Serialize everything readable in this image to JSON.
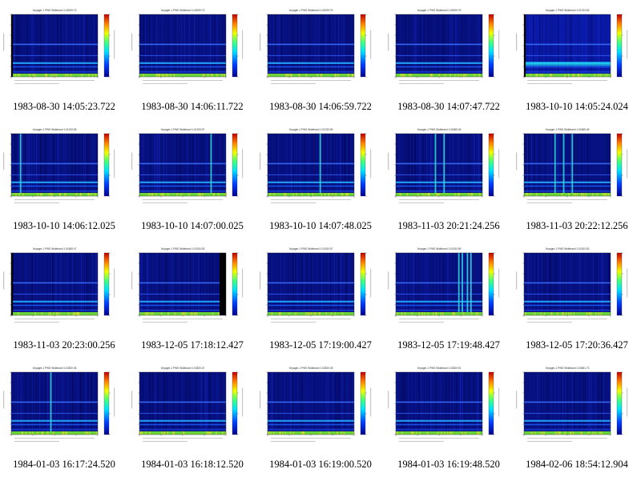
{
  "panels": [
    {
      "caption": "1983-08-30 14:05:23.722",
      "title": "Voyager-1 PWS Wideband 1:00029:73",
      "seed": 11,
      "leftEdge": true,
      "blackRight": false,
      "bright": false,
      "cyanBars": []
    },
    {
      "caption": "1983-08-30 14:06:11.722",
      "title": "Voyager-1 PWS Wideband 1:00029:73",
      "seed": 12,
      "leftEdge": false,
      "blackRight": false,
      "bright": false,
      "cyanBars": []
    },
    {
      "caption": "1983-08-30 14:06:59.722",
      "title": "Voyager-1 PWS Wideband 1:00029:75",
      "seed": 13,
      "leftEdge": false,
      "blackRight": false,
      "bright": false,
      "cyanBars": []
    },
    {
      "caption": "1983-08-30 14:07:47.722",
      "title": "Voyager-1 PWS Wideband 1:00029:75",
      "seed": 14,
      "leftEdge": false,
      "blackRight": false,
      "bright": false,
      "cyanBars": []
    },
    {
      "caption": "1983-10-10 14:05:24.024",
      "title": "Voyager-1 PWS Wideband 1:01233:53",
      "seed": 15,
      "leftEdge": true,
      "blackRight": false,
      "bright": true,
      "cyanBars": []
    },
    {
      "caption": "1983-10-10 14:06:12.025",
      "title": "Voyager-1 PWS Wideband 1:01233:55",
      "seed": 21,
      "leftEdge": false,
      "blackRight": false,
      "bright": false,
      "cyanBars": [
        0.1
      ]
    },
    {
      "caption": "1983-10-10 14:07:00.025",
      "title": "Voyager-1 PWS Wideband 1:01233:57",
      "seed": 22,
      "leftEdge": false,
      "blackRight": false,
      "bright": false,
      "cyanBars": [
        0.82
      ]
    },
    {
      "caption": "1983-10-10 14:07:48.025",
      "title": "Voyager-1 PWS Wideband 1:01233:59",
      "seed": 23,
      "leftEdge": false,
      "blackRight": false,
      "bright": false,
      "cyanBars": [
        0.6
      ]
    },
    {
      "caption": "1983-11-03 20:21:24.256",
      "title": "Voyager-1 PWS Wideband 1:01865:45",
      "seed": 24,
      "leftEdge": false,
      "blackRight": false,
      "bright": false,
      "cyanBars": [
        0.45,
        0.55
      ]
    },
    {
      "caption": "1983-11-03 20:22:12.256",
      "title": "Voyager-1 PWS Wideband 1:01865:49",
      "seed": 25,
      "leftEdge": false,
      "blackRight": false,
      "bright": false,
      "cyanBars": [
        0.35,
        0.45,
        0.55
      ]
    },
    {
      "caption": "1983-11-03 20:23:00.256",
      "title": "Voyager-1 PWS Wideband 1:01865:47",
      "seed": 31,
      "leftEdge": true,
      "blackRight": false,
      "bright": false,
      "cyanBars": []
    },
    {
      "caption": "1983-12-05 17:18:12.427",
      "title": "Voyager-1 PWS Wideband 1:02153:53",
      "seed": 32,
      "leftEdge": false,
      "blackRight": true,
      "bright": false,
      "cyanBars": []
    },
    {
      "caption": "1983-12-05 17:19:00.427",
      "title": "Voyager-1 PWS Wideband 1:02153:57",
      "seed": 33,
      "leftEdge": false,
      "blackRight": false,
      "bright": false,
      "cyanBars": []
    },
    {
      "caption": "1983-12-05 17:19:48.427",
      "title": "Voyager-1 PWS Wideband 1:02153:59",
      "seed": 34,
      "leftEdge": false,
      "blackRight": false,
      "bright": false,
      "cyanBars": [
        0.72,
        0.76,
        0.82,
        0.86
      ]
    },
    {
      "caption": "1983-12-05 17:20:36.427",
      "title": "Voyager-1 PWS Wideband 1:02153:53",
      "seed": 35,
      "leftEdge": false,
      "blackRight": false,
      "bright": false,
      "cyanBars": []
    },
    {
      "caption": "1984-01-03 16:17:24.520",
      "title": "Voyager-1 PWS Wideband 1:02820:45",
      "seed": 41,
      "leftEdge": false,
      "blackRight": false,
      "bright": false,
      "cyanBars": [
        0.45
      ]
    },
    {
      "caption": "1984-01-03 16:18:12.520",
      "title": "Voyager-1 PWS Wideband 1:02820:47",
      "seed": 42,
      "leftEdge": false,
      "blackRight": false,
      "bright": false,
      "cyanBars": []
    },
    {
      "caption": "1984-01-03 16:19:00.520",
      "title": "Voyager-1 PWS Wideband 1:02820:49",
      "seed": 43,
      "leftEdge": false,
      "blackRight": false,
      "bright": false,
      "cyanBars": []
    },
    {
      "caption": "1984-01-03 16:19:48.520",
      "title": "Voyager-1 PWS Wideband 1:02820:51",
      "seed": 44,
      "leftEdge": false,
      "blackRight": false,
      "bright": false,
      "cyanBars": []
    },
    {
      "caption": "1984-02-06 18:54:12.904",
      "title": "Voyager-1 PWS Wideband 1:03651:73",
      "seed": 45,
      "leftEdge": false,
      "blackRight": false,
      "bright": false,
      "cyanBars": []
    }
  ]
}
